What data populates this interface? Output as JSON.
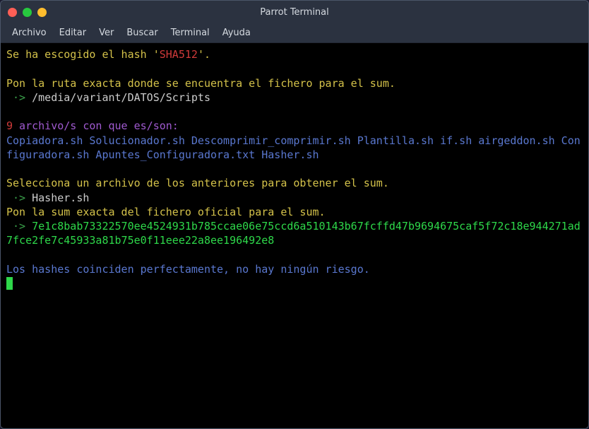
{
  "window": {
    "title": "Parrot Terminal"
  },
  "menubar": {
    "items": [
      "Archivo",
      "Editar",
      "Ver",
      "Buscar",
      "Terminal",
      "Ayuda"
    ]
  },
  "lines": {
    "l1a": "Se ha escogido el hash '",
    "l1b": "SHA512",
    "l1c": "'.",
    "l2": "Pon la ruta exacta donde se encuentra el fichero para el sum.",
    "l3a": " ·> ",
    "l3b": "/media/variant/DATOS/Scripts",
    "l4a": "9",
    "l4b": " archivo/s con que es/son:",
    "l5": "Copiadora.sh Solucionador.sh Descomprimir_comprimir.sh Plantilla.sh if.sh airgeddon.sh Configuradora.sh Apuntes_Configuradora.txt Hasher.sh",
    "l6": "Selecciona un archivo de los anteriores para obtener el sum.",
    "l7a": " ·> ",
    "l7b": "Hasher.sh",
    "l8": "Pon la sum exacta del fichero oficial para el sum.",
    "l9a": " ·> ",
    "l9b": "7e1c8bab73322570ee4524931b785ccae06e75ccd6a510143b67fcffd47b9694675caf5f72c18e944271ad7fce2fe7c45933a81b75e0f11eee22a8ee196492e8",
    "l10": "Los hashes coinciden perfectamente, no hay ningún riesgo."
  }
}
